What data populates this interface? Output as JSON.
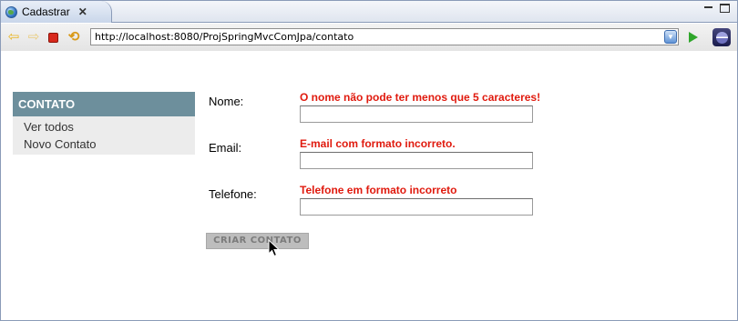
{
  "tab": {
    "title": "Cadastrar",
    "close_glyph": "✕",
    "icon": "globe-icon"
  },
  "window": {
    "minimize_icon": "minimize-icon",
    "maximize_icon": "maximize-icon"
  },
  "toolbar": {
    "url": "http://localhost:8080/ProjSpringMvcComJpa/contato",
    "back_glyph": "⇦",
    "forward_glyph": "⇨",
    "refresh_glyph": "⟲"
  },
  "sidebar": {
    "header": "CONTATO",
    "items": [
      {
        "label": "Ver todos"
      },
      {
        "label": "Novo Contato"
      }
    ]
  },
  "form": {
    "fields": [
      {
        "label": "Nome:",
        "error": "O nome não pode ter menos que 5 caracteres!",
        "value": ""
      },
      {
        "label": "Email:",
        "error": "E-mail com formato incorreto.",
        "value": ""
      },
      {
        "label": "Telefone:",
        "error": "Telefone em formato incorreto",
        "value": ""
      }
    ],
    "submit_label": "CRIAR CONTATO"
  },
  "colors": {
    "sidebar_header_bg": "#6d8f9c",
    "sidebar_list_bg": "#ececec",
    "error_text": "#e01a0e",
    "submit_bg": "#bdbdbd"
  }
}
